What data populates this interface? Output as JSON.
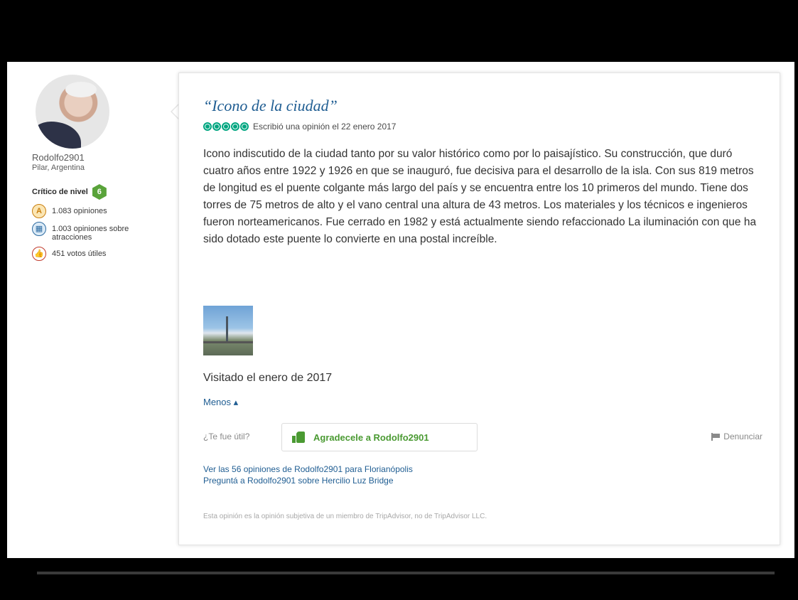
{
  "user": {
    "name": "Rodolfo2901",
    "location": "Pilar, Argentina",
    "level_label": "Crítico de nivel",
    "level_number": "6",
    "stats": [
      {
        "icon": "review-pen-icon",
        "glyph": "A",
        "text": "1.083 opiniones"
      },
      {
        "icon": "attraction-icon",
        "glyph": "▦",
        "text": "1.003 opiniones sobre atracciones"
      },
      {
        "icon": "helpful-thumb-icon",
        "glyph": "👍",
        "text": "451 votos útiles"
      }
    ]
  },
  "review": {
    "title": "“Icono de la ciudad”",
    "rating": 5,
    "rating_color": "#00a680",
    "written_date": "Escribió una opinión el 22 enero 2017",
    "body": "Icono indiscutido de la ciudad tanto por su valor histórico como por lo paisajístico. Su construcción, que duró cuatro años entre 1922 y 1926 en que se inauguró, fue decisiva para el desarrollo de la isla. Con sus 819 metros de longitud es el puente colgante más largo del país y se encuentra entre los 10 primeros del mundo. Tiene dos torres de 75 metros de alto y el vano central una altura de 43 metros. Los materiales y los técnicos e ingenieros fueron norteamericanos. Fue cerrado en 1982 y está actualmente siendo refaccionado La iluminación con que ha sido dotado este puente lo convierte en una postal increíble.",
    "visited": "Visitado el enero de 2017",
    "less_label": "Menos",
    "helpful_question": "¿Te fue útil?",
    "thanks_button": "Agradecele a Rodolfo2901",
    "report_label": "Denunciar",
    "link_reviews": "Ver las 56 opiniones de Rodolfo2901 para Florianópolis",
    "link_ask": "Preguntá a Rodolfo2901 sobre Hercilio Luz Bridge",
    "disclaimer": "Esta opinión es la opinión subjetiva de un miembro de TripAdvisor, no de TripAdvisor LLC."
  },
  "colors": {
    "link_blue": "#1f5d92",
    "green": "#4a9a32",
    "background": "#000000"
  }
}
